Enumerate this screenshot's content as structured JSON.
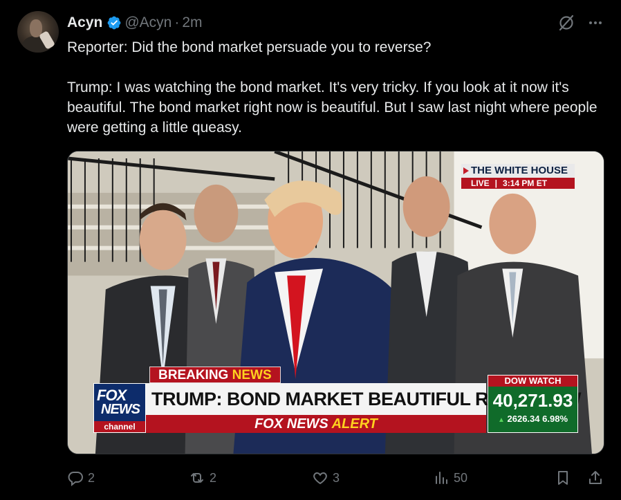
{
  "tweet": {
    "author_name": "Acyn",
    "handle": "@Acyn",
    "separator": "·",
    "time": "2m",
    "text_line1": "Reporter: Did the bond market persuade you to reverse?",
    "text_line2": "Trump: I was watching the bond market. It's very tricky. If you look at it now it's beautiful. The bond market right now is beautiful. But I saw last night where people were getting a little queasy."
  },
  "media": {
    "location_bug": "THE WHITE HOUSE",
    "live_label": "LIVE",
    "live_sep": "|",
    "live_time": "3:14 PM ET",
    "breaking_word1": "BREAKING",
    "breaking_word2": "NEWS",
    "channel_logo_line1": "FOX",
    "channel_logo_line2": "NEWS",
    "channel_logo_line3": "channel",
    "headline": "TRUMP: BOND MARKET BEAUTIFUL RIGHT NOW",
    "alert_brand": "FOX NEWS",
    "alert_word": "ALERT",
    "dow_label": "DOW WATCH",
    "dow_value": "40,271.93",
    "dow_change": "2626.34",
    "dow_pct": "6.98%"
  },
  "actions": {
    "replies": "2",
    "reposts": "2",
    "likes": "3",
    "views": "50"
  },
  "colors": {
    "background": "#000000",
    "text": "#e7e9ea",
    "muted": "#71767b",
    "verified": "#1d9bf0",
    "fox_red": "#b4131f",
    "fox_blue": "#0d2c6b",
    "dow_green": "#106b2a"
  },
  "icons": [
    "verified-badge-icon",
    "grok-icon",
    "more-icon",
    "reply-icon",
    "repost-icon",
    "like-icon",
    "views-icon",
    "bookmark-icon",
    "share-icon"
  ]
}
